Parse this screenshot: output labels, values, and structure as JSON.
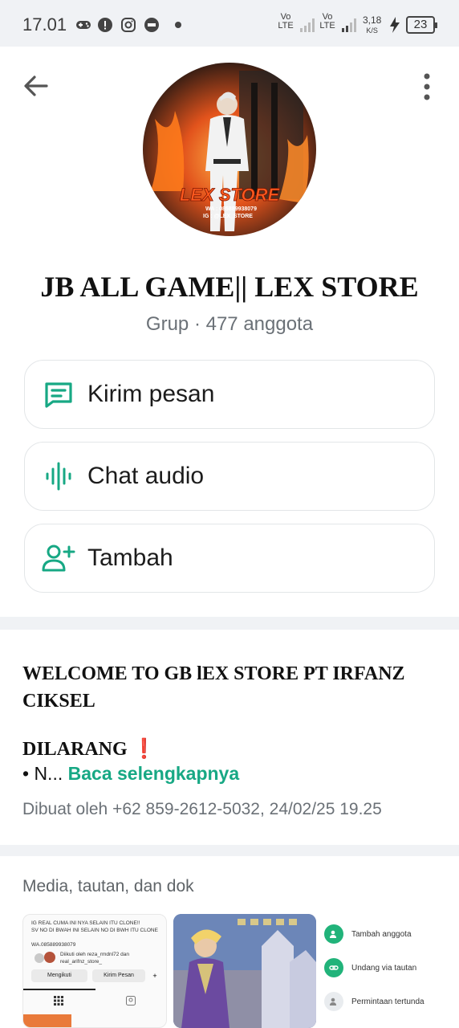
{
  "status_bar": {
    "time": "17.01",
    "network1": "Vo LTE",
    "network2": "Vo LTE",
    "speed": "3,18",
    "speed_unit": "K/S",
    "battery": "23"
  },
  "header": {
    "group_name": "JB ALL GAME|| LEX STORE",
    "group_meta": "Grup · 477 anggota",
    "avatar_text": "LEX STORE",
    "avatar_wa": "WA : 085889938079",
    "avatar_ig": "IG : @LEX_STORE"
  },
  "actions": [
    {
      "label": "Kirim pesan",
      "icon": "message-icon"
    },
    {
      "label": "Chat audio",
      "icon": "audio-wave-icon"
    },
    {
      "label": "Tambah",
      "icon": "add-person-icon"
    }
  ],
  "description": {
    "title": "WELCOME TO GB lEX STORE PT IRFANZ CIKSEL",
    "rule_heading": "DILARANG",
    "rule_emoji": "❗",
    "preview": "• N...",
    "read_more": "Baca selengkapnya",
    "created": "Dibuat oleh +62 859-2612-5032, 24/02/25 19.25"
  },
  "media": {
    "title": "Media, tautan, dan dok",
    "thumb1_lines": [
      "IG REAL CUMA INI NYA SELAIN ITU CLONE!!",
      "SV NO DI BWAH INI SELAIN NO DI BWH ITU CLONE",
      "WA.085889938079"
    ],
    "thumb1_follow": "Diikuti oleh reza_rmdnl72 dan real_arifnz_store_",
    "thumb1_btn1": "Mengikuti",
    "thumb1_btn2": "Kirim Pesan",
    "thumb3_items": [
      "Tambah anggota",
      "Undang via tautan",
      "Permintaan tertunda"
    ]
  },
  "colors": {
    "accent": "#17a884",
    "background": "#f0f2f5",
    "card": "#ffffff"
  }
}
